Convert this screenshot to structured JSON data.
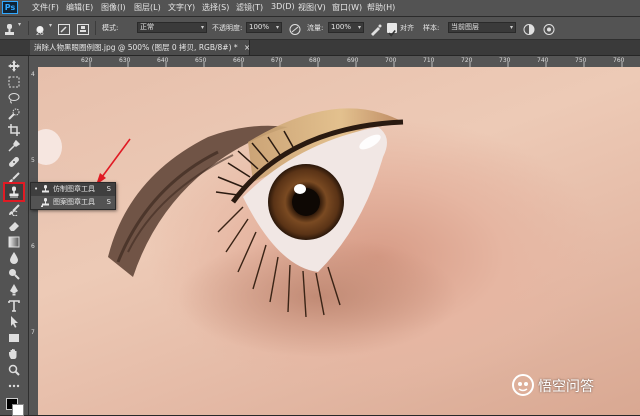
{
  "app": {
    "logo_text": "Ps"
  },
  "menu": [
    "文件(F)",
    "编辑(E)",
    "图像(I)",
    "图层(L)",
    "文字(Y)",
    "选择(S)",
    "滤镜(T)",
    "3D(D)",
    "视图(V)",
    "窗口(W)",
    "帮助(H)"
  ],
  "options_bar": {
    "brush_size": "26",
    "mode_label": "模式:",
    "mode_value": "正常",
    "opacity_label": "不透明度:",
    "opacity_value": "100%",
    "flow_label": "流量:",
    "flow_value": "100%",
    "align_label": "对齐",
    "align_checked": true,
    "sample_label": "样本:",
    "sample_value": "当前图层"
  },
  "document_tab": {
    "title": "消除人物黑眼圈例图.jpg @ 500% (图层 0 拷贝, RGB/8#) *",
    "close": "×"
  },
  "ruler": {
    "labels": [
      "620",
      "630",
      "640",
      "650",
      "660",
      "670",
      "680",
      "690",
      "700",
      "710",
      "720",
      "730",
      "740",
      "750",
      "760",
      "770"
    ]
  },
  "ruler_v": {
    "labels": [
      "4",
      "5",
      "6",
      "7"
    ]
  },
  "flyout": {
    "items": [
      {
        "label": "仿制图章工具",
        "shortcut": "S",
        "selected": true,
        "bullet": "•"
      },
      {
        "label": "图案图章工具",
        "shortcut": "S",
        "selected": false,
        "bullet": ""
      }
    ]
  },
  "tools": [
    "move",
    "marquee",
    "lasso",
    "quick-select",
    "crop",
    "eyedropper",
    "healing",
    "brush",
    "clone-stamp",
    "history-brush",
    "eraser",
    "gradient",
    "blur",
    "dodge",
    "pen",
    "type",
    "path-select",
    "rectangle",
    "hand",
    "zoom",
    "more"
  ],
  "watermark": {
    "text": "悟空问答"
  },
  "colors": {
    "accent_red": "#e01b24",
    "ui_panel": "#535353",
    "ui_dark": "#282828"
  }
}
